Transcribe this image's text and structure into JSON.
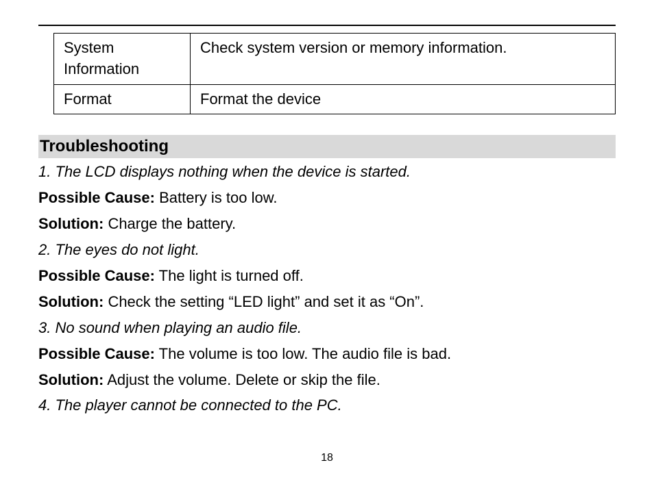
{
  "table": {
    "rows": [
      {
        "label": "System Information",
        "desc": "Check system version or memory information."
      },
      {
        "label": "Format",
        "desc": "Format the device"
      }
    ]
  },
  "section_heading": "Troubleshooting",
  "labels": {
    "possible_cause": "Possible Cause:",
    "solution": "Solution:"
  },
  "items": [
    {
      "problem": "1. The LCD displays nothing when the device is started.",
      "cause": "Battery is too low.",
      "solution": "Charge the battery."
    },
    {
      "problem": "2. The eyes do not light.",
      "cause": "The light is turned off.",
      "solution": "Check the setting “LED light” and set it as “On”."
    },
    {
      "problem": "3. No sound when playing an audio file.",
      "cause": "The volume is too low. The audio file is bad.",
      "solution": "Adjust the volume. Delete or skip the file."
    },
    {
      "problem": "4. The player cannot be connected to the PC."
    }
  ],
  "page_number": "18"
}
